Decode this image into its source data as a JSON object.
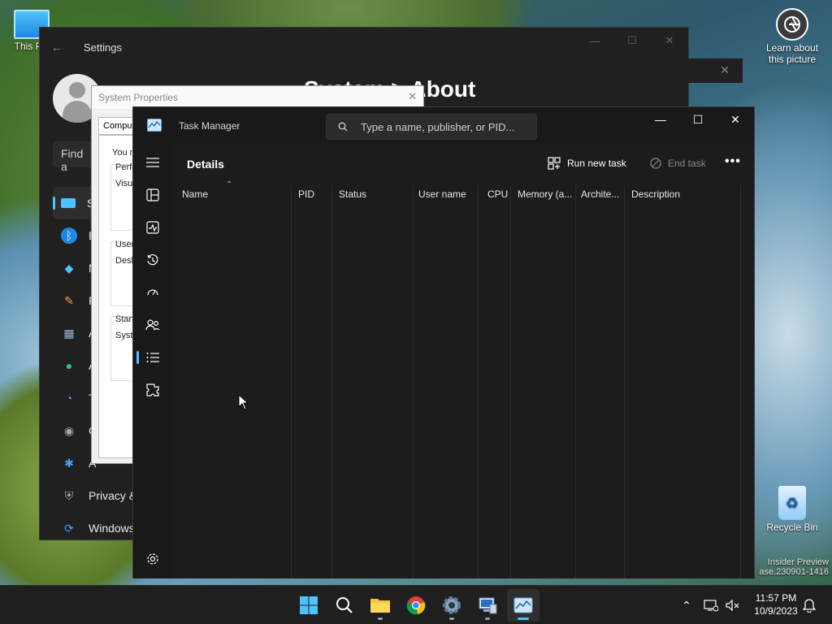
{
  "desktop": {
    "icons": [
      {
        "label": "This PC"
      },
      {
        "label": "Learn about this picture"
      },
      {
        "label": "Recycle Bin"
      }
    ],
    "watermark": {
      "line1": "Insider Preview",
      "line2": "ase.230901-1416"
    }
  },
  "settings_window": {
    "title": "Settings",
    "heading": "System  >  About",
    "search_placeholder": "Find a",
    "nav": [
      {
        "label": "S",
        "icon": "system-icon",
        "active": true
      },
      {
        "label": "B",
        "icon": "bluetooth-icon"
      },
      {
        "label": "N",
        "icon": "network-icon"
      },
      {
        "label": "P",
        "icon": "personalization-icon"
      },
      {
        "label": "A",
        "icon": "apps-icon"
      },
      {
        "label": "A",
        "icon": "accounts-icon"
      },
      {
        "label": "T",
        "icon": "time-language-icon"
      },
      {
        "label": "G",
        "icon": "gaming-icon"
      },
      {
        "label": "A",
        "icon": "accessibility-icon"
      },
      {
        "label": "Privacy &",
        "icon": "privacy-icon"
      },
      {
        "label": "Windows",
        "icon": "windows-update-icon"
      }
    ]
  },
  "system_properties": {
    "title": "System Properties",
    "tab": "Compute",
    "text_you": "You m",
    "perf": "Perfo",
    "visual": "Visua",
    "user": "User",
    "desk": "Desk",
    "start": "Start",
    "syst": "Syste"
  },
  "task_manager": {
    "title": "Task Manager",
    "search_placeholder": "Type a name, publisher, or PID...",
    "page_title": "Details",
    "run_new_task": "Run new task",
    "end_task": "End task",
    "more": "•••",
    "columns": [
      "Name",
      "PID",
      "Status",
      "User name",
      "CPU",
      "Memory (a...",
      "Archite...",
      "Description"
    ],
    "rail": [
      "menu-icon",
      "processes-icon",
      "performance-icon",
      "app-history-icon",
      "startup-apps-icon",
      "users-icon",
      "details-icon",
      "services-icon",
      "settings-icon"
    ],
    "active_rail": "details-icon"
  },
  "taskbar": {
    "apps": [
      "start-icon",
      "search-icon",
      "file-explorer-icon",
      "chrome-icon",
      "settings-app-icon",
      "system-properties-app-icon",
      "task-manager-app-icon"
    ],
    "time": "11:57 PM",
    "date": "10/9/2023"
  },
  "colors": {
    "accent": "#4cc2ff",
    "tm_bg": "#191919"
  }
}
